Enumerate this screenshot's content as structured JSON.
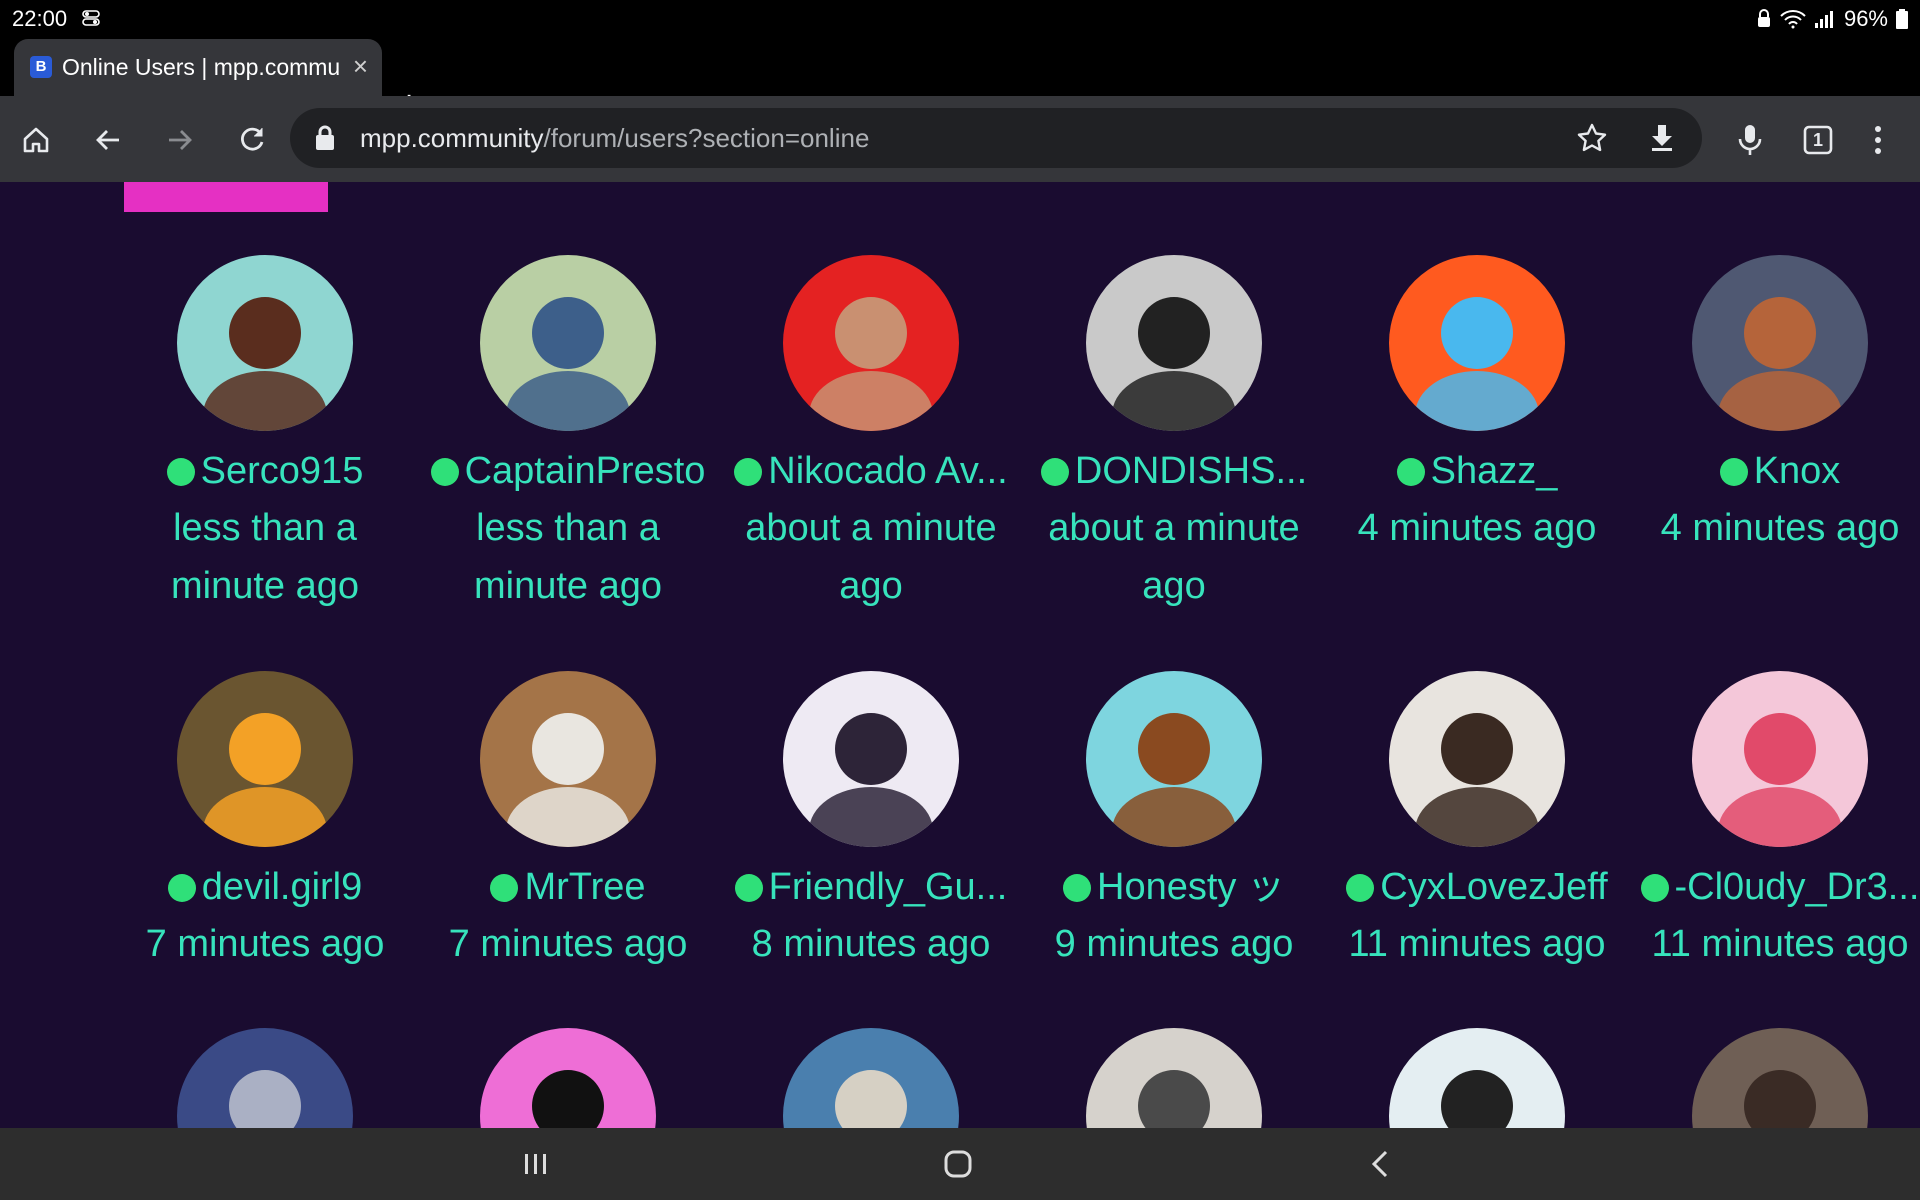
{
  "status_bar": {
    "time": "22:00",
    "battery": "96%"
  },
  "tab": {
    "title": "Online Users | mpp.community",
    "favicon_letter": "B"
  },
  "omnibox": {
    "host": "mpp.community",
    "path": "/forum/users?section=online"
  },
  "tab_count": "1",
  "users": [
    {
      "name": "Serco915",
      "last_seen": "less than a minute ago",
      "avatar": {
        "bg": "#8fd6d1",
        "fg": "#5a2d1e"
      }
    },
    {
      "name": "CaptainPresto",
      "last_seen": "less than a minute ago",
      "avatar": {
        "bg": "#b9cfa4",
        "fg": "#3d5f8a"
      }
    },
    {
      "name": "Nikocado Av...",
      "last_seen": "about a minute ago",
      "avatar": {
        "bg": "#e42222",
        "fg": "#c99071"
      }
    },
    {
      "name": "DONDISHS...",
      "last_seen": "about a minute ago",
      "avatar": {
        "bg": "#c9c9c9",
        "fg": "#222222"
      }
    },
    {
      "name": "Shazz_",
      "last_seen": "4 minutes ago",
      "avatar": {
        "bg": "#ff5a1f",
        "fg": "#49b8ee"
      }
    },
    {
      "name": "Knox",
      "last_seen": "4 minutes ago",
      "avatar": {
        "bg": "#4f5872",
        "fg": "#b5643a"
      }
    },
    {
      "name": "devil.girl9",
      "last_seen": "7 minutes ago",
      "avatar": {
        "bg": "#6a5530",
        "fg": "#f3a126"
      }
    },
    {
      "name": "MrTree",
      "last_seen": "7 minutes ago",
      "avatar": {
        "bg": "#a47448",
        "fg": "#e9e6e0"
      }
    },
    {
      "name": "Friendly_Gu...",
      "last_seen": "8 minutes ago",
      "avatar": {
        "bg": "#eeeaf3",
        "fg": "#2d2438"
      }
    },
    {
      "name": "Honesty ッ",
      "last_seen": "9 minutes ago",
      "avatar": {
        "bg": "#7ed5df",
        "fg": "#8a4a20"
      }
    },
    {
      "name": "CyxLovezJeff",
      "last_seen": "11 minutes ago",
      "avatar": {
        "bg": "#e8e4df",
        "fg": "#3a2a22"
      }
    },
    {
      "name": "-Cl0udy_Dr3...",
      "last_seen": "11 minutes ago",
      "avatar": {
        "bg": "#f4c7d9",
        "fg": "#e14a6a"
      }
    },
    {
      "name": "",
      "last_seen": "",
      "avatar": {
        "bg": "#3a4a86",
        "fg": "#aab0c4"
      }
    },
    {
      "name": "",
      "last_seen": "",
      "avatar": {
        "bg": "#ee6ed6",
        "fg": "#111111"
      }
    },
    {
      "name": "",
      "last_seen": "",
      "avatar": {
        "bg": "#4a7fae",
        "fg": "#d6d0c4"
      }
    },
    {
      "name": "",
      "last_seen": "",
      "avatar": {
        "bg": "#d6d2cc",
        "fg": "#4a4a4a"
      }
    },
    {
      "name": "",
      "last_seen": "",
      "avatar": {
        "bg": "#e4eef2",
        "fg": "#222222"
      }
    },
    {
      "name": "",
      "last_seen": "",
      "avatar": {
        "bg": "#6f5f55",
        "fg": "#3a2b25"
      }
    }
  ],
  "icons": {
    "status_toggle": "toggle-icon",
    "lock_status": "lock-icon",
    "wifi": "wifi-icon",
    "signal": "signal-icon",
    "battery": "battery-icon",
    "home": "home-icon",
    "back": "back-arrow-icon",
    "forward": "forward-arrow-icon",
    "reload": "reload-icon",
    "secure": "lock-icon",
    "bookmark": "star-icon",
    "download": "download-icon",
    "voice": "microphone-icon",
    "tabs": "tab-switcher-icon",
    "menu": "more-vert-icon",
    "recent_apps": "recents-icon",
    "home_nav": "home-circle-icon",
    "back_nav": "back-chevron-icon"
  }
}
